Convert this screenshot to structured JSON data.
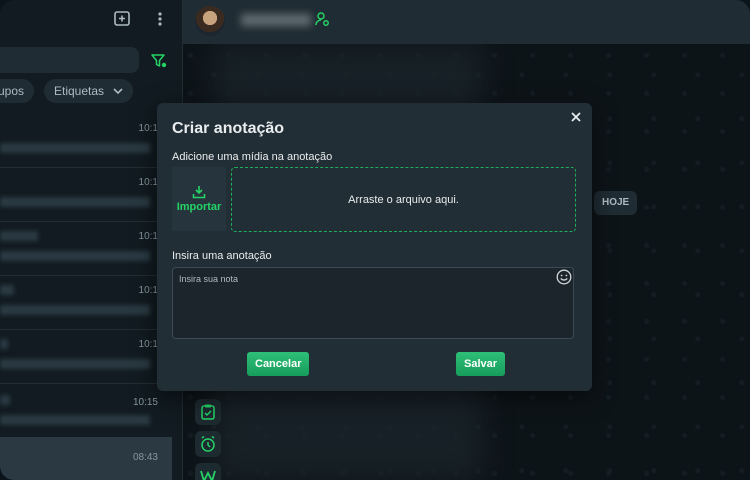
{
  "left_panel": {
    "chips": [
      {
        "label": "rupos"
      },
      {
        "label": "Etiquetas"
      }
    ],
    "rows": [
      {
        "time": "10:1"
      },
      {
        "time": "10:1"
      },
      {
        "time": "10:1"
      },
      {
        "time": "10:1"
      },
      {
        "time": "10:1"
      },
      {
        "time": "10:15"
      },
      {
        "time": "08:43"
      }
    ]
  },
  "chat": {
    "date_badge": "HOJE"
  },
  "modal": {
    "title": "Criar anotação",
    "media_label": "Adicione uma mídia na anotação",
    "import_label": "Importar",
    "dropzone_text": "Arraste o arquivo aqui.",
    "note_label": "Insira uma anotação",
    "note_placeholder": "Insira sua nota",
    "note_value": "",
    "cancel_label": "Cancelar",
    "save_label": "Salvar"
  },
  "colors": {
    "accent": "#25d366",
    "panel": "#111b21",
    "modal": "#222e35"
  }
}
